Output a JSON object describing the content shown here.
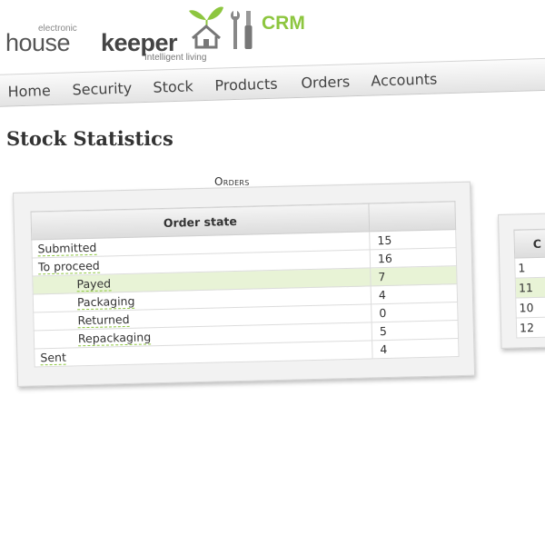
{
  "brand": {
    "small": "electronic",
    "house": "house",
    "keeper": "keeper",
    "tagline": "Intelligent living",
    "crm": "CRM",
    "accent_color": "#8dc63f"
  },
  "nav": {
    "items": [
      {
        "label": "Home"
      },
      {
        "label": "Security"
      },
      {
        "label": "Stock"
      },
      {
        "label": "Products"
      },
      {
        "label": "Orders"
      },
      {
        "label": "Accounts"
      }
    ]
  },
  "page_title": "Stock Statistics",
  "orders_panel": {
    "title": "Orders",
    "columns": [
      "Order state",
      ""
    ],
    "rows": [
      {
        "label": "Submitted",
        "value": "15"
      },
      {
        "label": "To proceed",
        "value": "16"
      },
      {
        "label": "Payed",
        "value": "7"
      },
      {
        "label": "Packaging",
        "value": "4"
      },
      {
        "label": "Returned",
        "value": "0"
      },
      {
        "label": "Repackaging",
        "value": "5"
      },
      {
        "label": "Sent",
        "value": "4"
      }
    ]
  },
  "second_panel": {
    "header": "C",
    "values": [
      "1",
      "11",
      "10",
      "12"
    ]
  }
}
